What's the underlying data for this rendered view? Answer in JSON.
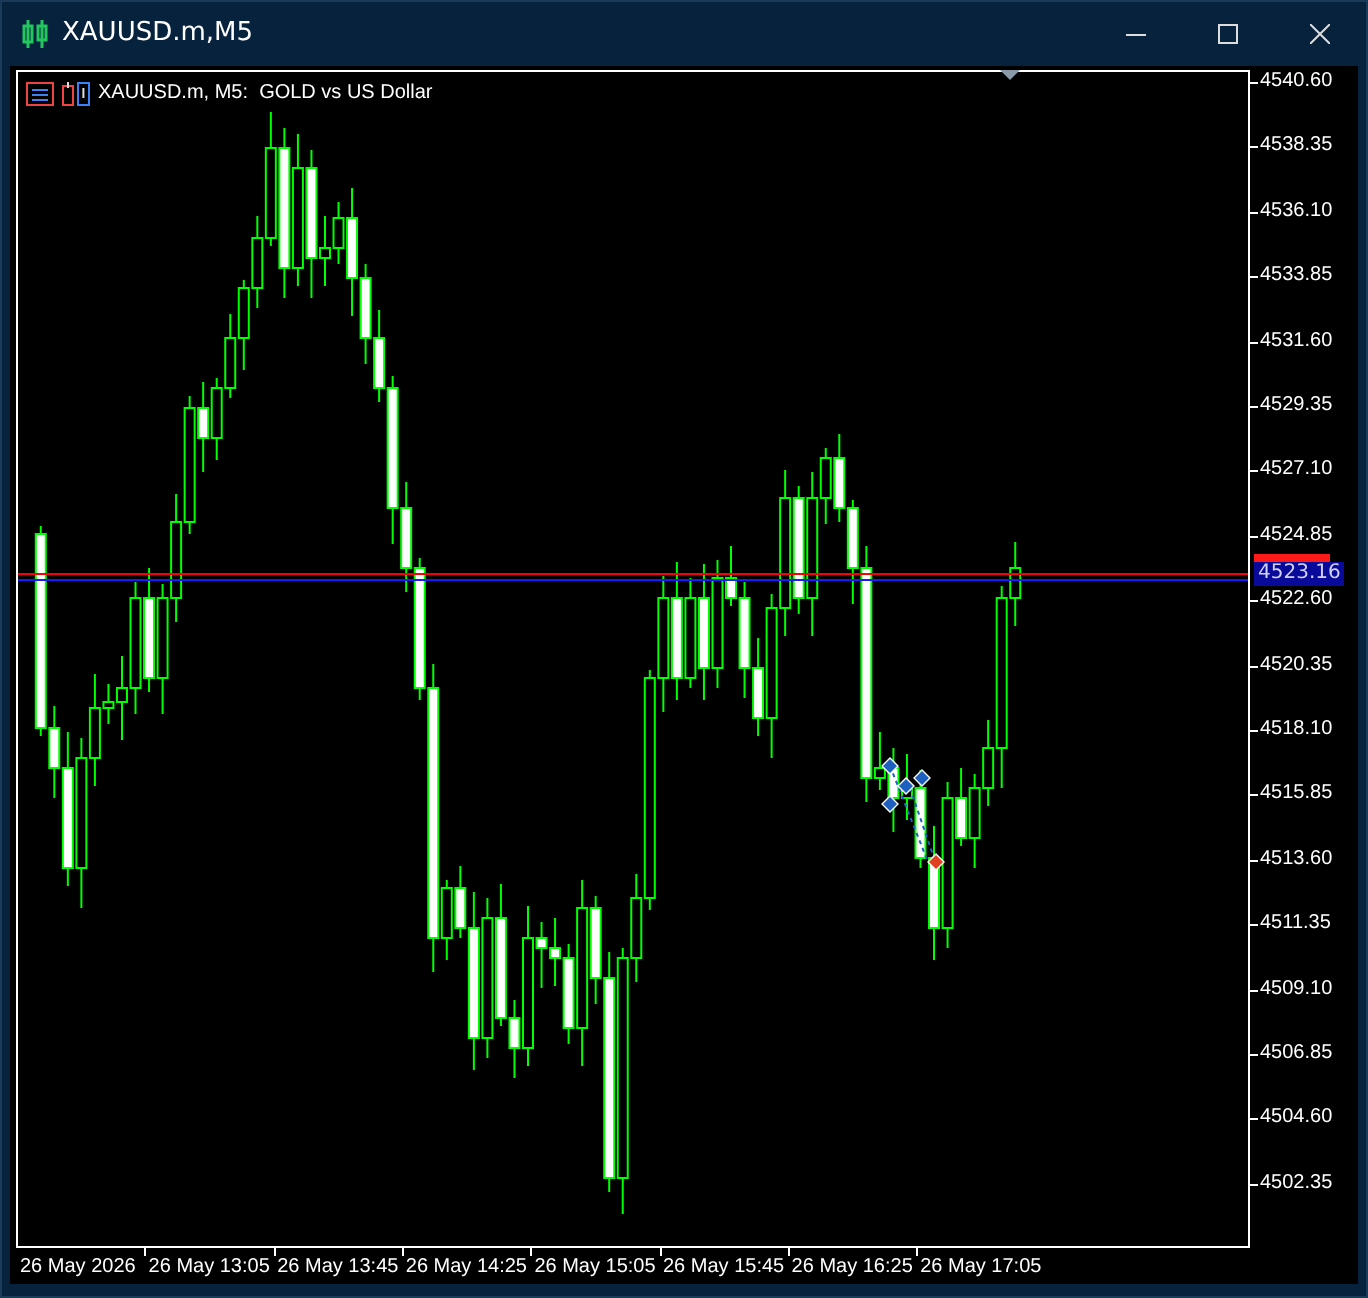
{
  "window": {
    "title": "XAUUSD.m,M5"
  },
  "chart": {
    "header": "XAUUSD.m, M5:  GOLD vs US Dollar",
    "price_axis": [
      "4540.60",
      "4538.35",
      "4536.10",
      "4533.85",
      "4531.60",
      "4529.35",
      "4527.10",
      "4524.85",
      "4522.60",
      "4520.35",
      "4518.10",
      "4515.85",
      "4513.60",
      "4511.35",
      "4509.10",
      "4506.85",
      "4504.60",
      "4502.35"
    ],
    "bid_label": "4523.16",
    "time_axis": [
      "26 May 2026",
      "26 May 13:05",
      "26 May 13:45",
      "26 May 14:25",
      "26 May 15:05",
      "26 May 15:45",
      "26 May 16:25",
      "26 May 17:05"
    ]
  }
}
